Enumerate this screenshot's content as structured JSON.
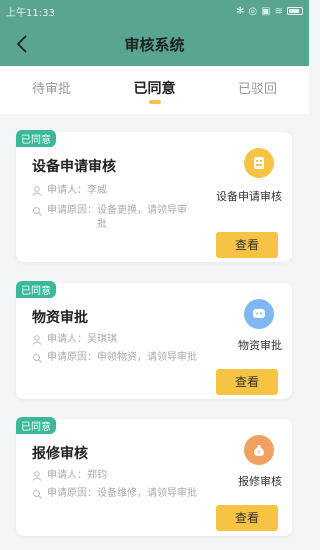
{
  "status": {
    "time": "上午11:33"
  },
  "nav": {
    "title": "审核系统"
  },
  "tabs": [
    {
      "label": "待审批"
    },
    {
      "label": "已同意"
    },
    {
      "label": "已驳回"
    }
  ],
  "cards": [
    {
      "badge": "已同意",
      "title": "设备申请审核",
      "applicant": "申请人：李威",
      "reason_line1": "申请原因：设备更换，请领导审",
      "reason_line2": "批",
      "side_label": "设备申请审核",
      "icon": "device-icon",
      "icon_color": "#f6c344",
      "button": "查看"
    },
    {
      "badge": "已同意",
      "title": "物资审批",
      "applicant": "申请人：吴琪琪",
      "reason_line1": "申请原因：申领物资，请领导审批",
      "reason_line2": "",
      "side_label": "物资审批",
      "icon": "message-icon",
      "icon_color": "#7fb8f0",
      "button": "查看"
    },
    {
      "badge": "已同意",
      "title": "报修审核",
      "applicant": "申请人：郑钧",
      "reason_line1": "申请原因：设备维修，请领导审批",
      "reason_line2": "",
      "side_label": "报修审核",
      "icon": "money-bag-icon",
      "icon_color": "#f0a060",
      "button": "查看"
    }
  ],
  "colors": {
    "header": "#5aa58f",
    "badge": "#3bb89a",
    "button": "#f6c344"
  }
}
